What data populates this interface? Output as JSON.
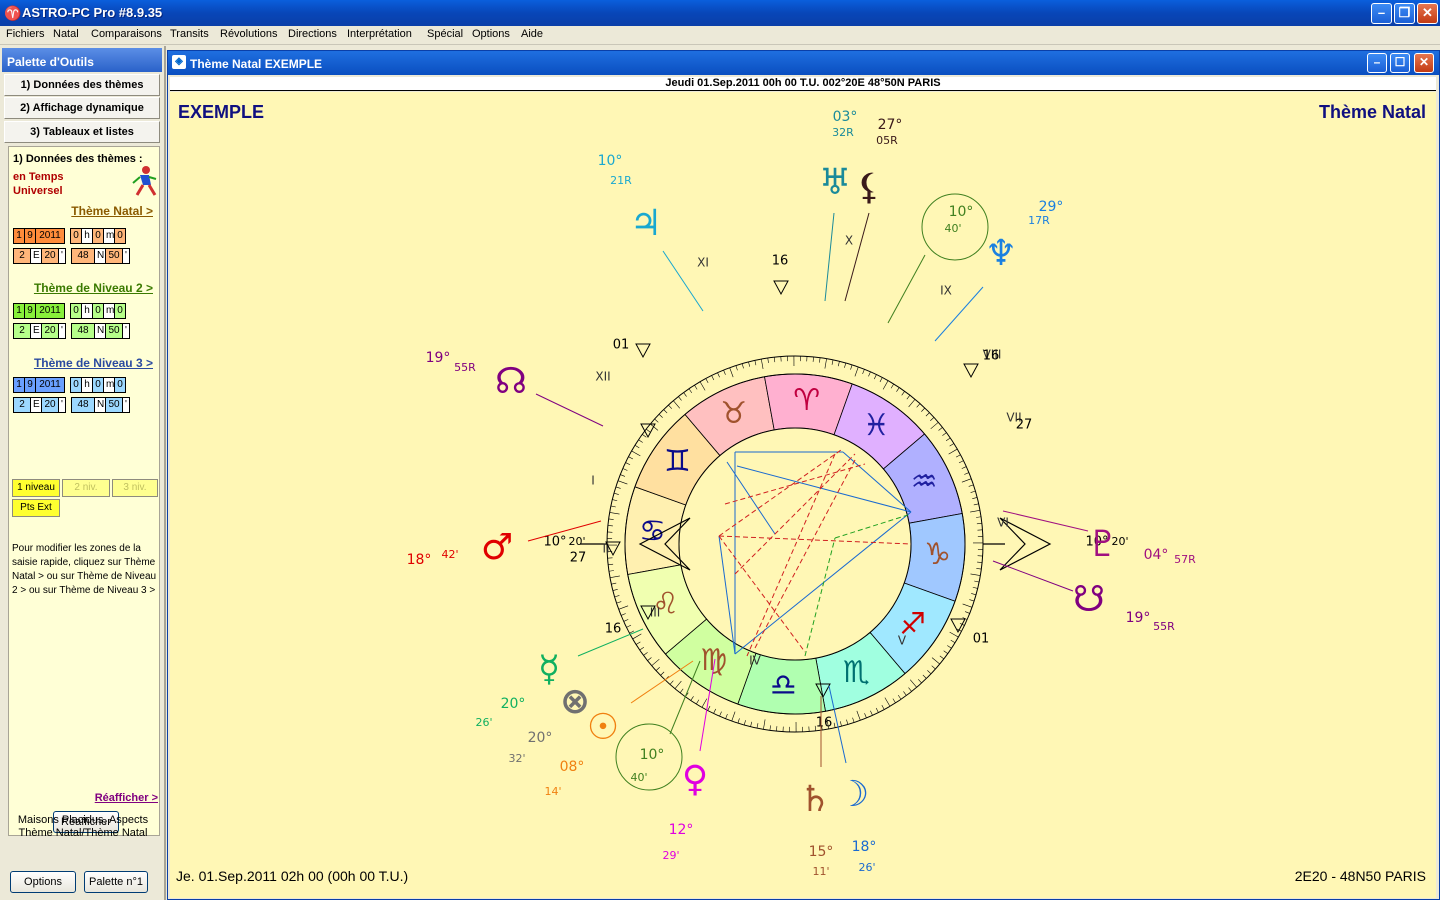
{
  "app": {
    "title": "ASTRO-PC Pro #8.9.35",
    "menu": [
      "Fichiers",
      "Natal",
      "Comparaisons",
      "Transits",
      "Révolutions",
      "Directions",
      "Interprétation",
      "Spécial",
      "Options",
      "Aide"
    ]
  },
  "palette": {
    "header": "Palette d'Outils",
    "tabs": [
      "1) Données des thèmes",
      "2) Affichage dynamique",
      "3) Tableaux et listes"
    ],
    "panel_title": "1) Données des thèmes :",
    "time_label_1": "en Temps",
    "time_label_2": "Universel",
    "levels": [
      {
        "link": "Thème Natal >",
        "color": "#8a5a00",
        "fill1": "#ff8c3a",
        "fill2": "#ffb67a",
        "date": [
          "1",
          "9",
          "2011"
        ],
        "time": [
          "0",
          "h",
          "0",
          "m",
          "0"
        ],
        "lon": [
          "2",
          "E",
          "20",
          "'"
        ],
        "lat": [
          "48",
          "N",
          "50",
          "'"
        ]
      },
      {
        "link": "Thème de Niveau 2 >",
        "color": "#3a7a00",
        "fill1": "#88f03a",
        "fill2": "#b6ff8a",
        "date": [
          "1",
          "9",
          "2011"
        ],
        "time": [
          "0",
          "h",
          "0",
          "m",
          "0"
        ],
        "lon": [
          "2",
          "E",
          "20",
          "'"
        ],
        "lat": [
          "48",
          "N",
          "50",
          "'"
        ]
      },
      {
        "link": "Thème de Niveau 3 >",
        "color": "#2a4aa0",
        "fill1": "#6aa0ff",
        "fill2": "#9cd8ff",
        "date": [
          "1",
          "9",
          "2011"
        ],
        "time": [
          "0",
          "h",
          "0",
          "m",
          "0"
        ],
        "lon": [
          "2",
          "E",
          "20",
          "'"
        ],
        "lat": [
          "48",
          "N",
          "50",
          "'"
        ]
      }
    ],
    "level_buttons": [
      "1 niveau",
      "2 niv.",
      "3 niv."
    ],
    "pts_ext": "Pts Ext",
    "help_text": "Pour modifier les zones de la saisie rapide, cliquez sur Thème Natal > ou sur Thème de Niveau 2 > ou sur Thème de Niveau 3 >",
    "reafficher_button": "Réafficher",
    "reafficher_link": "Réafficher >",
    "maisons_1": "Maisons Placidus, Aspects",
    "maisons_2": "Thème Natal/Thème Natal",
    "options_button": "Options",
    "palette_button": "Palette n°1"
  },
  "chart_window": {
    "title": "Thème Natal  EXEMPLE",
    "info": "Jeudi 01.Sep.2011 00h 00 T.U. 002°20E 48°50N  PARIS",
    "name": "EXEMPLE",
    "type": "Thème Natal",
    "footer_left": "Je. 01.Sep.2011 02h 00 (00h 00 T.U.)",
    "footer_right": "2E20 - 48N50  PARIS"
  },
  "chart_data": {
    "type": "astrological-wheel",
    "ascendant": {
      "deg": "10°",
      "min": "20'"
    },
    "descendant": {
      "deg": "10°",
      "min": "20'"
    },
    "signs": [
      {
        "glyph": "♋",
        "color": "#0a0a8a",
        "fill": "#fff0b0"
      },
      {
        "glyph": "♊",
        "color": "#0a0a8a",
        "fill": "#ffe0a0"
      },
      {
        "glyph": "♉",
        "color": "#a0522d",
        "fill": "#ffc0c0"
      },
      {
        "glyph": "♈",
        "color": "#c00040",
        "fill": "#ffb0d0"
      },
      {
        "glyph": "♓",
        "color": "#2020a0",
        "fill": "#e0b0ff"
      },
      {
        "glyph": "♒",
        "color": "#2020a0",
        "fill": "#b0b0ff"
      },
      {
        "glyph": "♑",
        "color": "#a0522d",
        "fill": "#a0c8ff"
      },
      {
        "glyph": "♐",
        "color": "#d00000",
        "fill": "#a0e8ff"
      },
      {
        "glyph": "♏",
        "color": "#007070",
        "fill": "#a0ffe0"
      },
      {
        "glyph": "♎",
        "color": "#0a0a8a",
        "fill": "#b0ffb0"
      },
      {
        "glyph": "♍",
        "color": "#a0522d",
        "fill": "#d0ffa0"
      },
      {
        "glyph": "♌",
        "color": "#a0522d",
        "fill": "#f0ffb0"
      }
    ],
    "house_numerals": [
      "I",
      "II",
      "III",
      "IV",
      "V",
      "VI",
      "VII",
      "VIII",
      "IX",
      "X",
      "XI",
      "XII"
    ],
    "cusp_degrees": [
      "27",
      "16",
      "01",
      "16",
      "27",
      "16",
      "01",
      "16"
    ],
    "planets": [
      {
        "name": "Uranus",
        "glyph": "♅",
        "color": "#1a8a9a",
        "deg": "03°",
        "min": "32R"
      },
      {
        "name": "Lilith",
        "glyph": "⚸",
        "color": "#3a1a1a",
        "deg": "27°",
        "min": "05R"
      },
      {
        "name": "Jupiter",
        "glyph": "♃",
        "color": "#19a8d0",
        "deg": "10°",
        "min": "21R"
      },
      {
        "name": "Neptune",
        "glyph": "♆",
        "color": "#1a80e0",
        "deg": "29°",
        "min": "17R"
      },
      {
        "name": "Midheaven",
        "glyph": "",
        "color": "#408020",
        "deg": "10°",
        "min": "40'"
      },
      {
        "name": "North Node",
        "glyph": "☊",
        "color": "#800080",
        "deg": "19°",
        "min": "55R"
      },
      {
        "name": "Mars",
        "glyph": "♂",
        "color": "#e00000",
        "deg": "18°",
        "min": "42'"
      },
      {
        "name": "Pluto",
        "glyph": "♇",
        "color": "#a01080",
        "deg": "04°",
        "min": "57R"
      },
      {
        "name": "South Node",
        "glyph": "☋",
        "color": "#800080",
        "deg": "19°",
        "min": "55R"
      },
      {
        "name": "Mercury",
        "glyph": "☿",
        "color": "#10b060",
        "deg": "20°",
        "min": "26'"
      },
      {
        "name": "Fortune",
        "glyph": "⊗",
        "color": "#707070",
        "deg": "20°",
        "min": "32'"
      },
      {
        "name": "Sun",
        "glyph": "☉",
        "color": "#f08010",
        "deg": "08°",
        "min": "14'"
      },
      {
        "name": "Imum Coeli",
        "glyph": "",
        "color": "#408020",
        "deg": "10°",
        "min": "40'"
      },
      {
        "name": "Venus",
        "glyph": "♀",
        "color": "#e000e0",
        "deg": "12°",
        "min": "29'"
      },
      {
        "name": "Saturn",
        "glyph": "♄",
        "color": "#a0522d",
        "deg": "15°",
        "min": "11'"
      },
      {
        "name": "Moon",
        "glyph": "☽",
        "color": "#1a6ad0",
        "deg": "18°",
        "min": "26'"
      }
    ]
  }
}
